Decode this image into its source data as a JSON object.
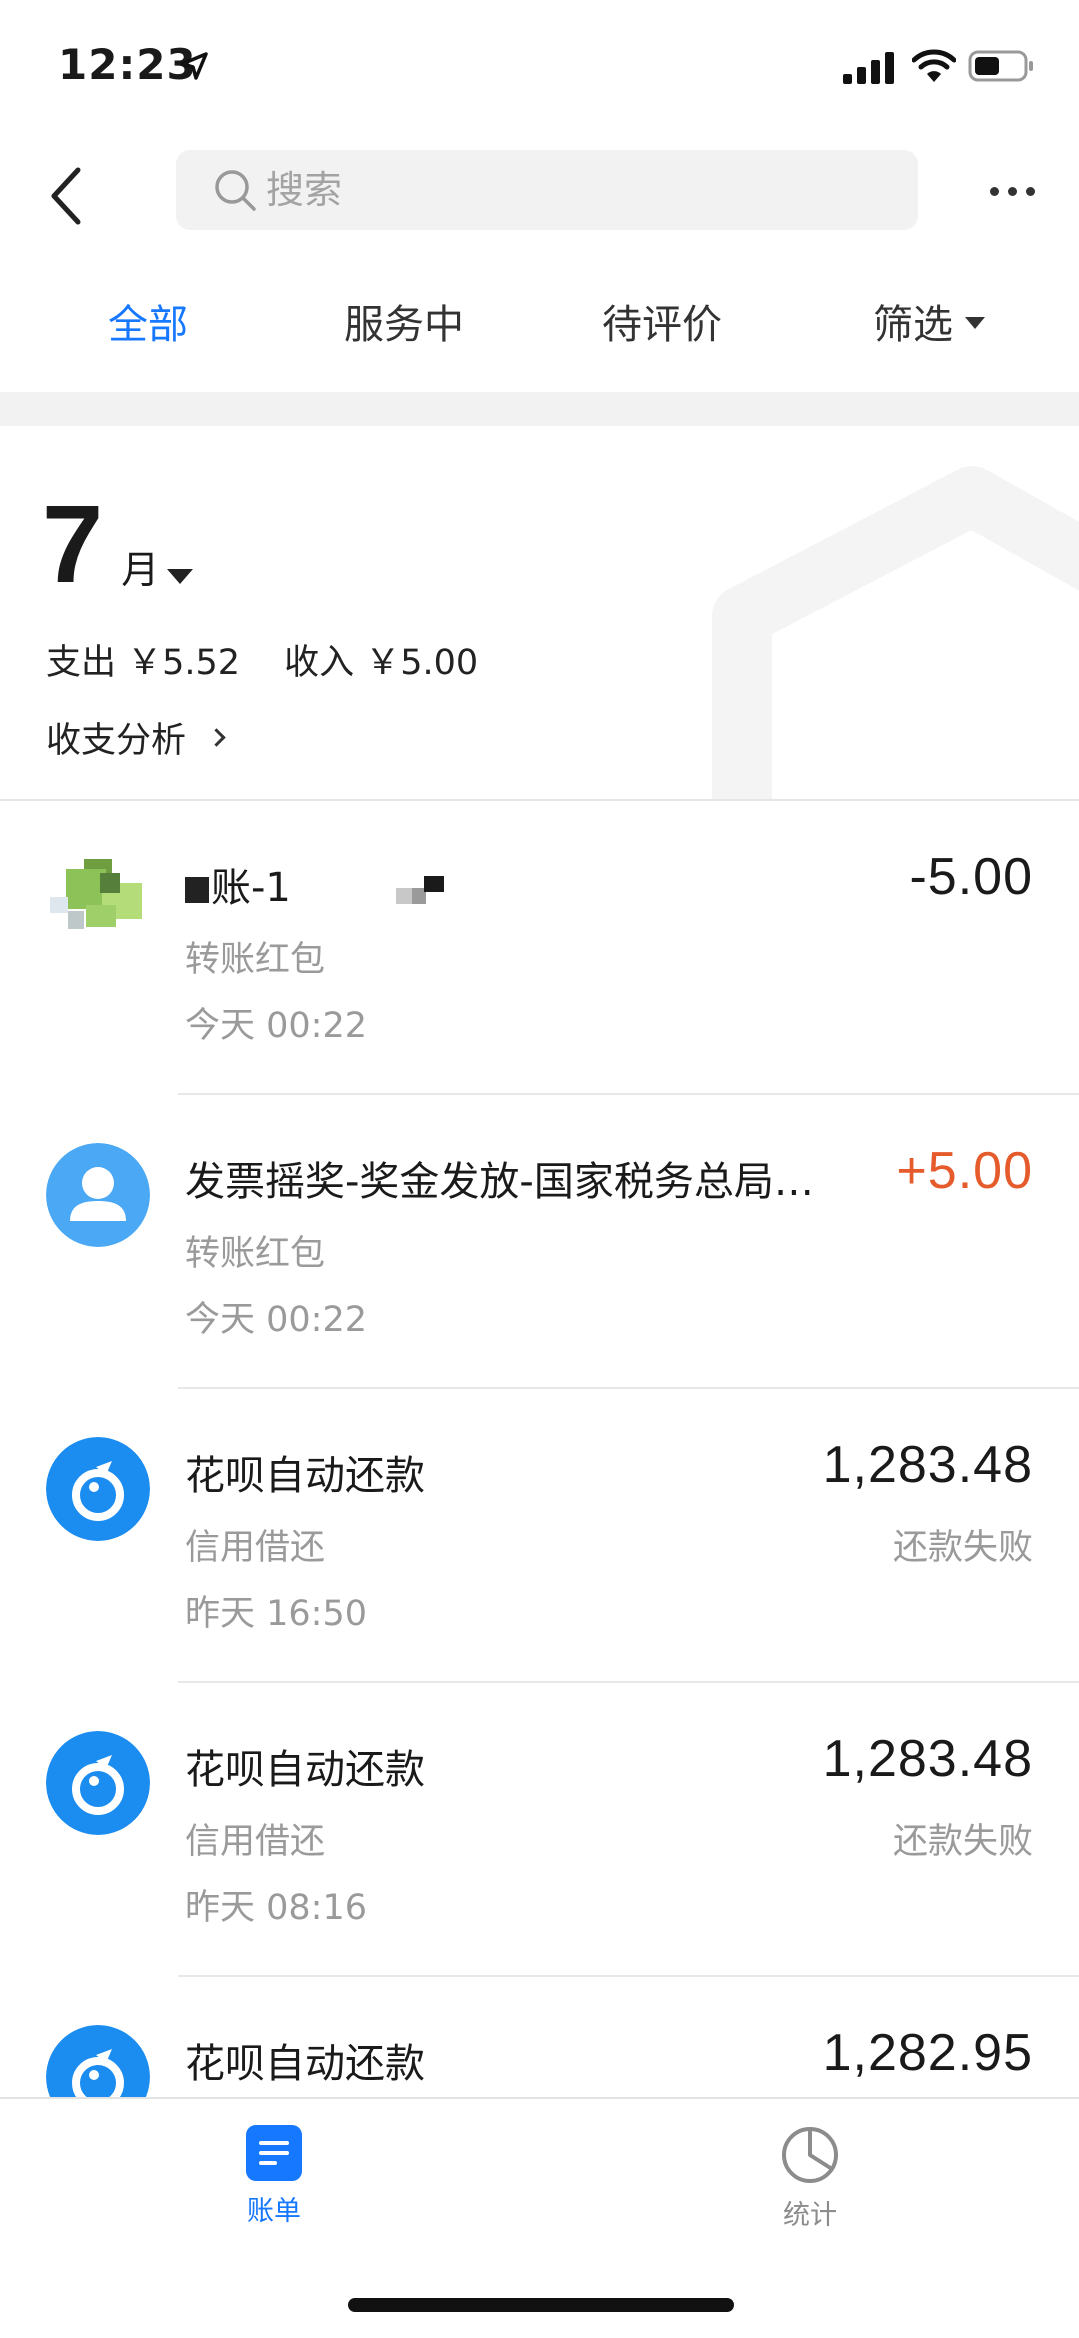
{
  "status_bar": {
    "time": "12:23"
  },
  "nav": {
    "search_placeholder": "搜索"
  },
  "tabs": {
    "all": "全部",
    "serving": "服务中",
    "pending_review": "待评价",
    "filter": "筛选"
  },
  "summary": {
    "month_number": "7",
    "month_unit": "月",
    "expense": "支出 ￥5.52",
    "income": "收入 ￥5.00",
    "analysis_link": "收支分析"
  },
  "transactions": [
    {
      "title": "账-1",
      "amount": "-5.00",
      "category": "转账红包",
      "time": "今天  00:22",
      "status": ""
    },
    {
      "title": "发票摇奖-奖金发放-国家税务总局…",
      "amount": "+5.00",
      "category": "转账红包",
      "time": "今天  00:22",
      "status": ""
    },
    {
      "title": "花呗自动还款",
      "amount": "1,283.48",
      "category": "信用借还",
      "time": "昨天  16:50",
      "status": "还款失败"
    },
    {
      "title": "花呗自动还款",
      "amount": "1,283.48",
      "category": "信用借还",
      "time": "昨天  08:16",
      "status": "还款失败"
    },
    {
      "title": "花呗自动还款",
      "amount": "1,282.95",
      "category": "",
      "time": "",
      "status": ""
    }
  ],
  "tabbar": {
    "bill": "账单",
    "stats": "统计"
  },
  "colors": {
    "accent": "#1677ff",
    "income": "#e55b2b",
    "huabei_blue": "#1b8cf0",
    "avatar_blue": "#4aa8f5"
  },
  "icons": {
    "back": "back-arrow-icon",
    "search": "search-icon",
    "more": "more-icon",
    "huabei": "huabei-icon",
    "user": "user-icon",
    "bill": "bill-icon",
    "stats": "pie-chart-icon"
  }
}
